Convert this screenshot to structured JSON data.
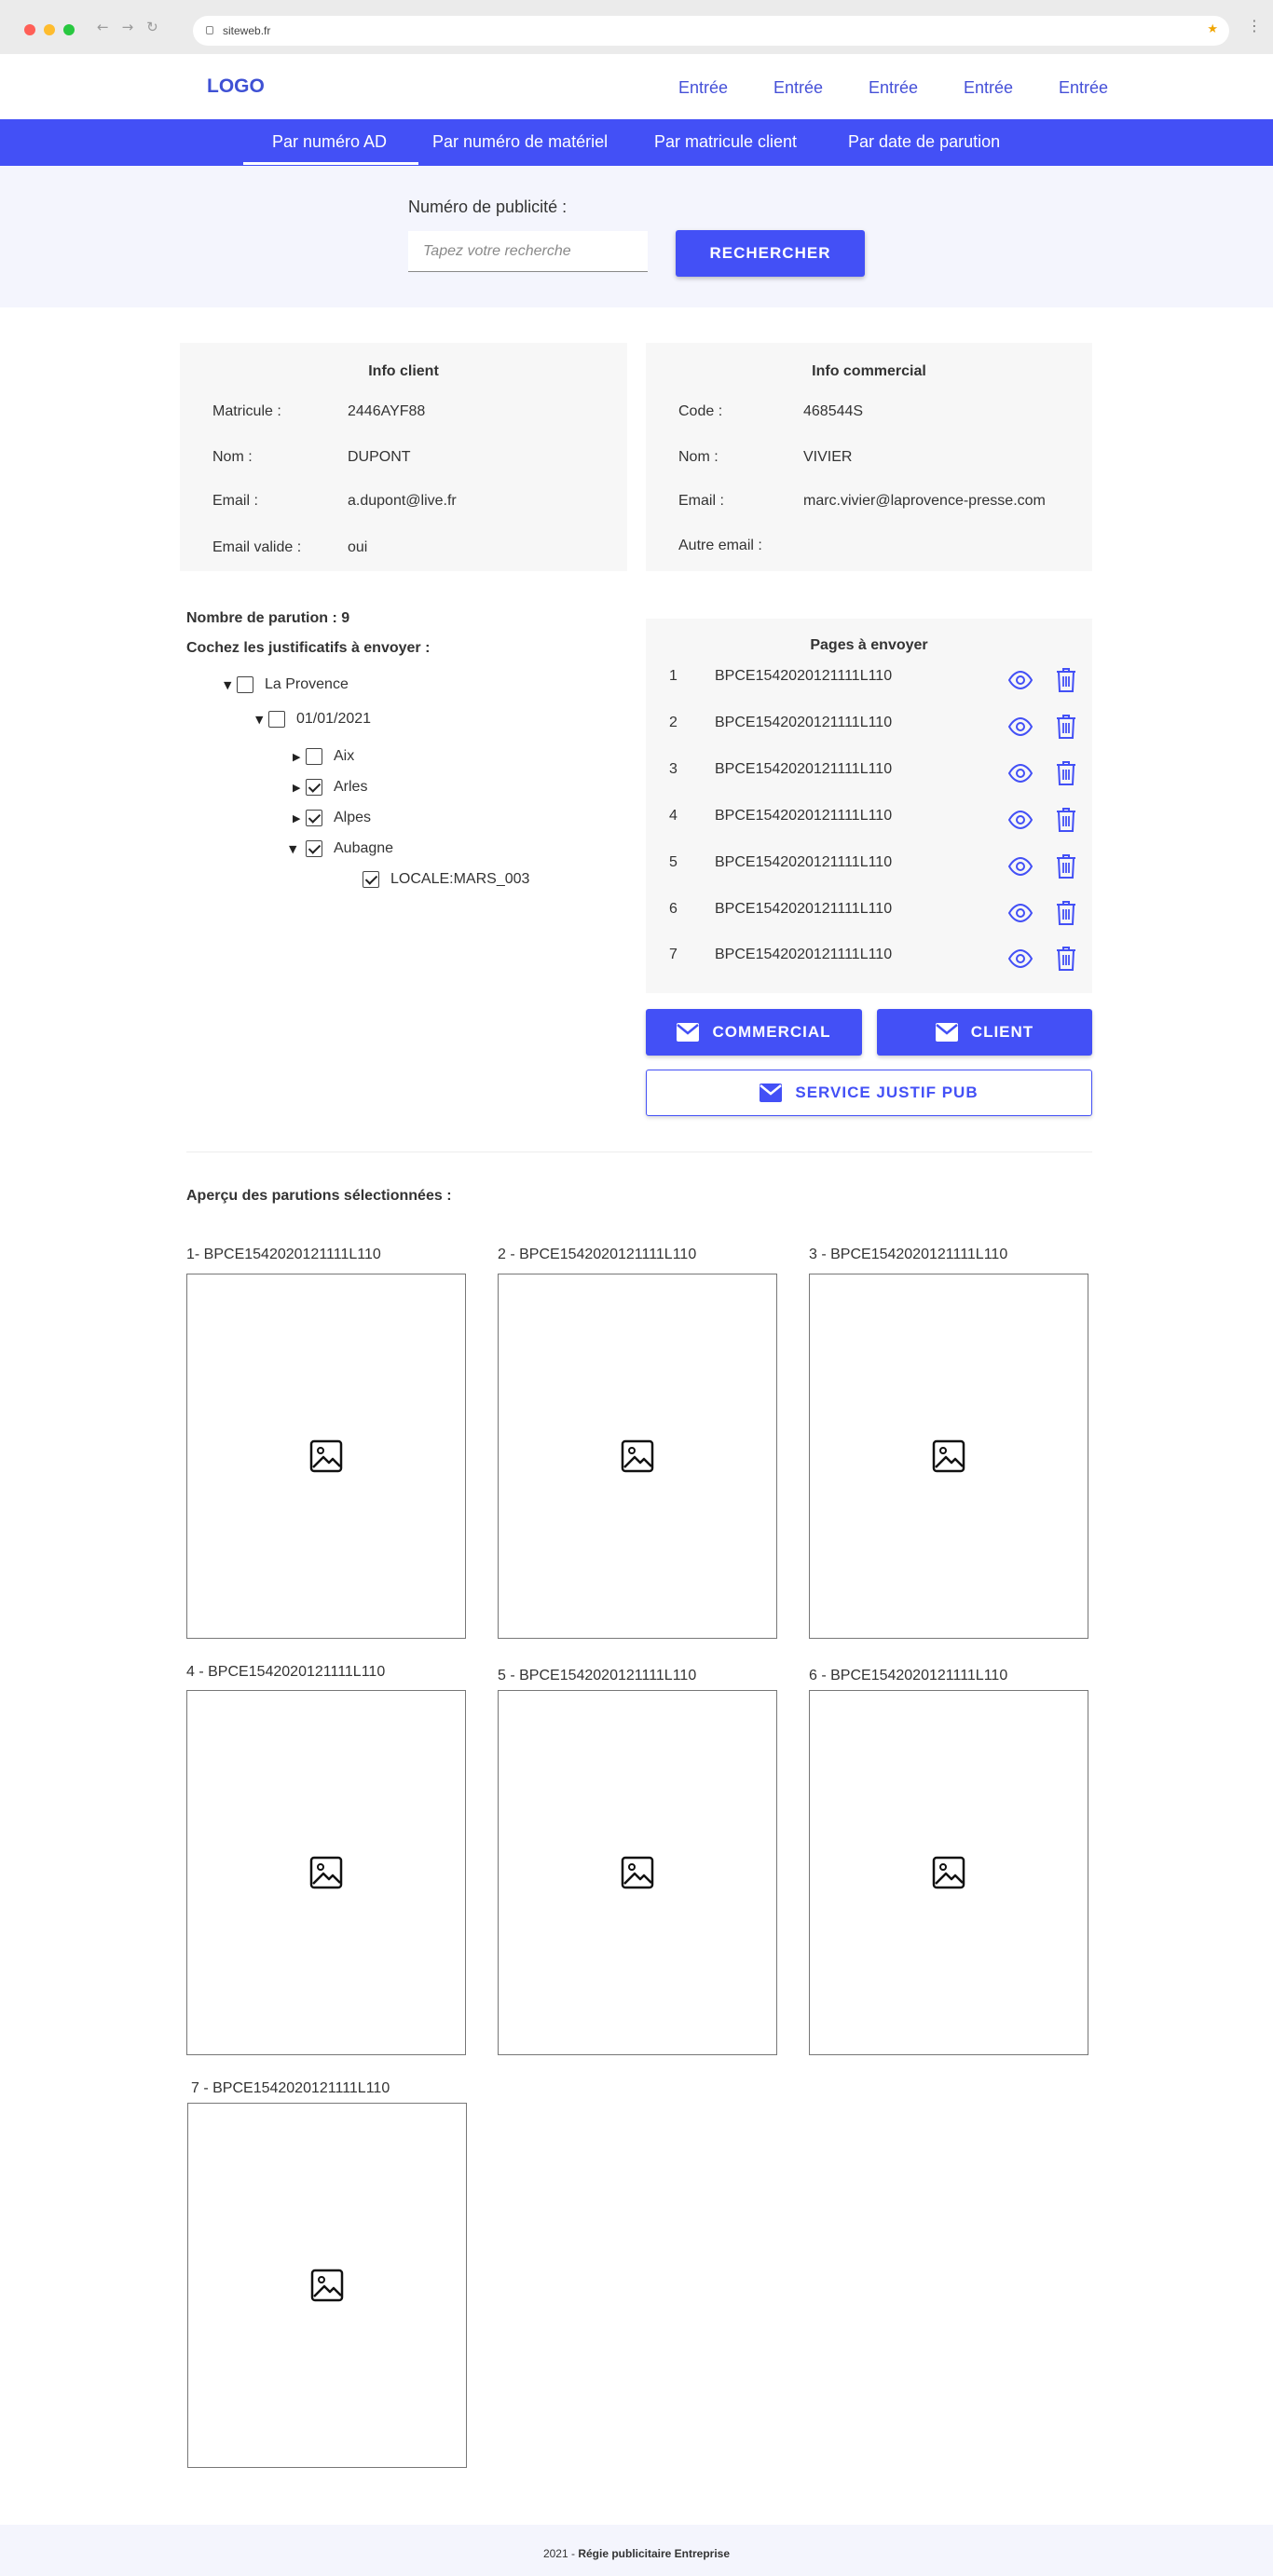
{
  "browser": {
    "url": "siteweb.fr",
    "window_dots": [
      "#ff5f57",
      "#febc2e",
      "#28c840"
    ],
    "accent": "#4350f6"
  },
  "header": {
    "logo": "LOGO",
    "nav": [
      "Entrée",
      "Entrée",
      "Entrée",
      "Entrée",
      "Entrée"
    ]
  },
  "tabs": [
    "Par numéro AD",
    "Par numéro de matériel",
    "Par matricule client",
    "Par date de parution"
  ],
  "active_tab": "Par numéro AD",
  "search": {
    "label": "Numéro de publicité :",
    "placeholder": "Tapez votre recherche",
    "value": "",
    "button": "RECHERCHER"
  },
  "client_info": {
    "title": "Info client",
    "rows": [
      {
        "label": "Matricule :",
        "value": "2446AYF88"
      },
      {
        "label": "Nom :",
        "value": "DUPONT"
      },
      {
        "label": "Email :",
        "value": "a.dupont@live.fr"
      },
      {
        "label": "Email valide :",
        "value": "oui"
      }
    ]
  },
  "commercial_info": {
    "title": "Info commercial",
    "rows": [
      {
        "label": "Code :",
        "value": "468544S"
      },
      {
        "label": "Nom :",
        "value": "VIVIER"
      },
      {
        "label": "Email :",
        "value": "marc.vivier@laprovence-presse.com"
      },
      {
        "label": "Autre email :",
        "value": ""
      }
    ]
  },
  "parutions": {
    "count_label": "Nombre de parution : 9",
    "check_label": "Cochez les justificatifs à envoyer :",
    "tree": [
      {
        "label": "La Provence",
        "caret": "down",
        "checked": false
      },
      {
        "label": "01/01/2021",
        "caret": "down",
        "checked": false
      },
      {
        "label": "Aix",
        "caret": "right",
        "checked": false
      },
      {
        "label": "Arles",
        "caret": "right",
        "checked": true
      },
      {
        "label": "Alpes",
        "caret": "right",
        "checked": true
      },
      {
        "label": "Aubagne",
        "caret": "down",
        "checked": true
      },
      {
        "label": "LOCALE:MARS_003",
        "caret": "none",
        "checked": true
      }
    ]
  },
  "pages": {
    "title": "Pages à envoyer",
    "rows": [
      {
        "num": "1",
        "code": "BPCE1542020121111L110"
      },
      {
        "num": "2",
        "code": "BPCE1542020121111L110"
      },
      {
        "num": "3",
        "code": "BPCE1542020121111L110"
      },
      {
        "num": "4",
        "code": "BPCE1542020121111L110"
      },
      {
        "num": "5",
        "code": "BPCE1542020121111L110"
      },
      {
        "num": "6",
        "code": "BPCE1542020121111L110"
      },
      {
        "num": "7",
        "code": "BPCE1542020121111L110"
      }
    ]
  },
  "actions": {
    "commercial": "COMMERCIAL",
    "client": "CLIENT",
    "service": "SERVICE JUSTIF PUB"
  },
  "preview": {
    "title": "Aperçu des parutions sélectionnées :",
    "items": [
      "1-  BPCE1542020121111L110",
      "2 - BPCE1542020121111L110",
      "3 - BPCE1542020121111L110",
      "4 - BPCE1542020121111L110",
      "5 - BPCE1542020121111L110",
      "6 - BPCE1542020121111L110",
      "7 - BPCE1542020121111L110"
    ]
  },
  "footer": {
    "year": "2021 - ",
    "company": "Régie publicitaire Entreprise"
  }
}
